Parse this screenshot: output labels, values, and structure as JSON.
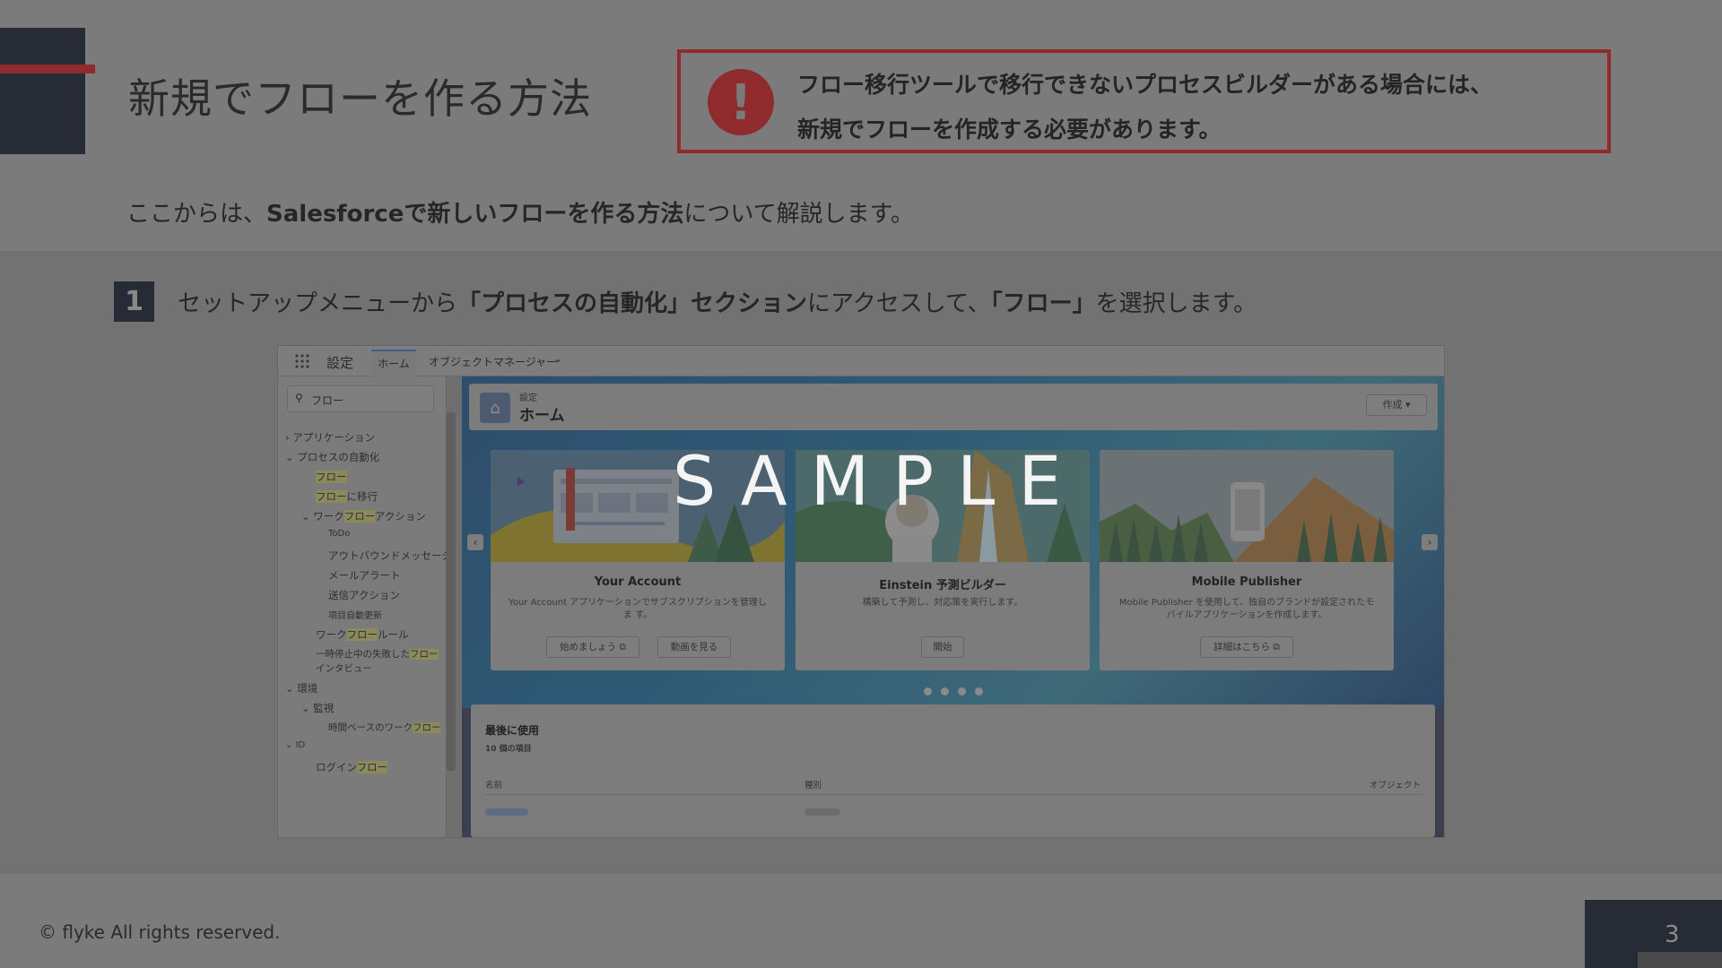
{
  "slide": {
    "title": "新規でフローを作る方法",
    "alert": {
      "icon": "exclamation-icon",
      "line1": "フロー移行ツールで移行できないプロセスビルダーがある場合には、",
      "line2": "新規でフローを作成する必要があります。"
    },
    "intro": {
      "before": "ここからは、",
      "bold": "Salesforceで新しいフローを作る方法",
      "after": "について解説します。"
    },
    "step": {
      "number": "1",
      "text_a": "セットアップメニューから",
      "bold_a": "「プロセスの自動化」セクション",
      "text_b": "にアクセスして、",
      "bold_b": "「フロー」",
      "text_c": "を選択します。"
    },
    "watermark": "SAMPLE",
    "copyright": "© flyke All rights reserved.",
    "page_number": "3"
  },
  "screenshot": {
    "header": {
      "setup": "設定",
      "home_tab": "ホーム",
      "object_manager": "オブジェクトマネージャー",
      "chevron": "⌄"
    },
    "search": {
      "value": "フロー"
    },
    "tree": {
      "applications": "アプリケーション",
      "process_automation": "プロセスの自動化",
      "flow": "フロー",
      "migrate_prefix": "フロー",
      "migrate_suffix": "に移行",
      "wf_actions_a": "ワーク",
      "wf_actions_b": "フロー",
      "wf_actions_c": "アクション",
      "todo": "ToDo",
      "outbound": "アウトバウンドメッセージ",
      "email_alert": "メールアラート",
      "send_action": "送信アクション",
      "field_update": "項目自動更新",
      "wf_rule_a": "ワーク",
      "wf_rule_b": "フロー",
      "wf_rule_c": "ルール",
      "paused_a": "一時停止中の失敗した",
      "paused_b": "フロー",
      "paused_c": "インタビュー",
      "environment": "環境",
      "monitoring": "監視",
      "time_based_a": "時間ベースのワーク",
      "time_based_b": "フロー",
      "id": "ID",
      "login_flow_a": "ログイン",
      "login_flow_b": "フロー"
    },
    "page_header": {
      "small": "設定",
      "title": "ホーム",
      "create": "作成 ▾"
    },
    "cards": [
      {
        "title": "Your Account",
        "desc": "Your Account アプリケーションでサブスクリプションを管理しま す。",
        "buttons": [
          "始めましょう ⧉",
          "動画を見る"
        ]
      },
      {
        "title": "Einstein 予測ビルダー",
        "desc": "構築して予測し、対応策を実行します。",
        "buttons": [
          "開始"
        ]
      },
      {
        "title": "Mobile Publisher",
        "desc": "Mobile Publisher を使用して、独自のブランドが設定されたモバイルアプリケーションを作成します。",
        "buttons": [
          "詳細はこちら ⧉"
        ]
      }
    ],
    "carousel": {
      "prev": "‹",
      "next": "›"
    },
    "recent": {
      "title": "最後に使用",
      "count": "10 個の項目",
      "col_name": "名前",
      "col_type": "種別",
      "col_object": "オブジェクト"
    }
  },
  "colors": {
    "accent_red": "#8f2a2d",
    "navy": "#262b36",
    "overlay_gray": "#7a7a7a"
  }
}
